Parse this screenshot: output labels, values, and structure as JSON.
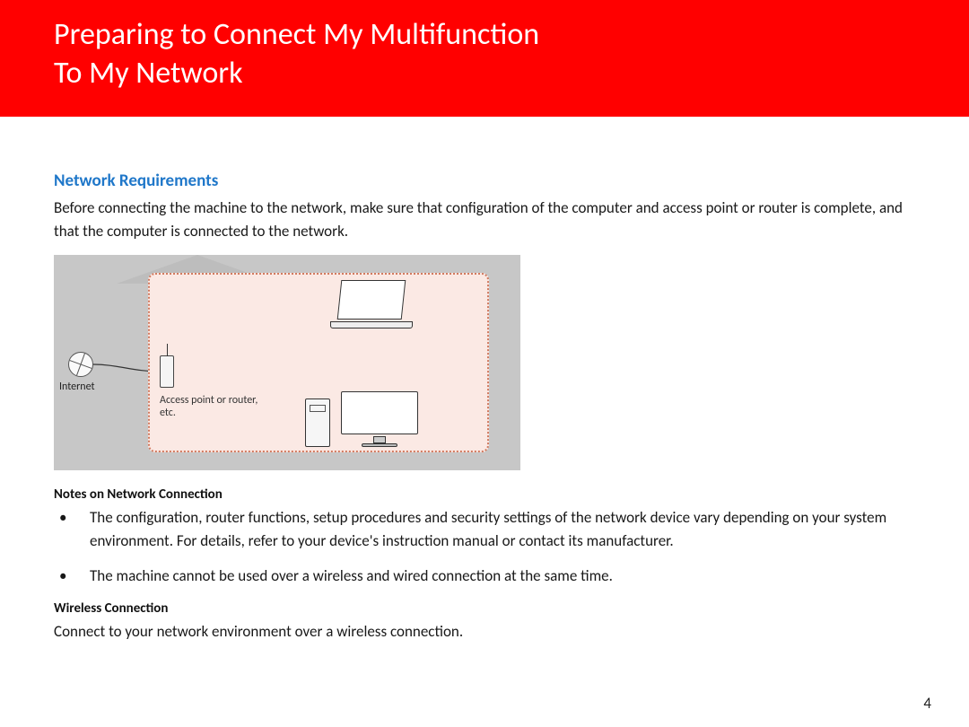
{
  "header": {
    "title_line1": "Preparing to Connect My Multifunction",
    "title_line2": "To My Network"
  },
  "section": {
    "heading": "Network Requirements",
    "intro": "Before connecting the machine to the network, make sure that configuration of the computer and access point or router is complete, and that the computer is connected to the network."
  },
  "diagram": {
    "internet_label": "Internet",
    "router_label": "Access point or router, etc."
  },
  "notes": {
    "heading": "Notes on Network Connection",
    "items": [
      "The configuration, router functions, setup procedures and security settings of the network device vary depending on your system environment. For details, refer to your device's instruction manual or contact its manufacturer.",
      "The machine cannot be used over a wireless and wired connection at the same time."
    ]
  },
  "wireless": {
    "heading": "Wireless Connection",
    "text": "Connect to your network environment over a wireless connection."
  },
  "page_number": "4"
}
